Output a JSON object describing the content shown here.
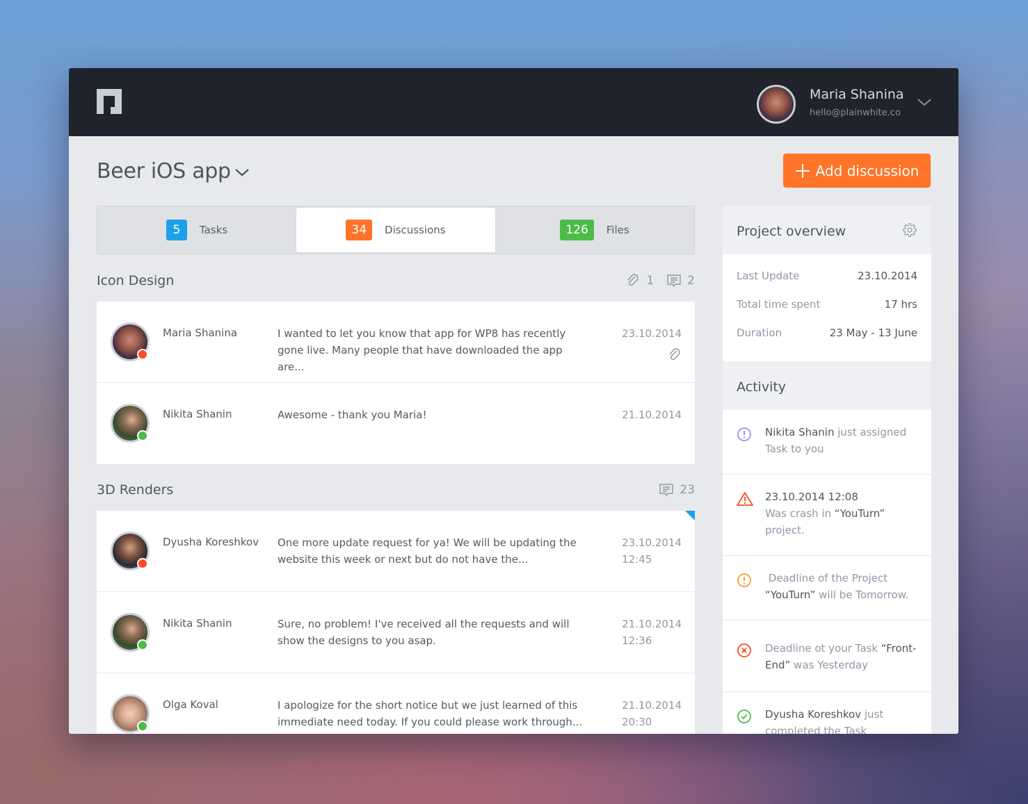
{
  "header": {
    "logo": "plainwhite-logo",
    "user": {
      "name": "Maria Shanina",
      "email": "hello@plainwhite.co",
      "avatar": "avatar-maria"
    }
  },
  "project": {
    "title": "Beer iOS app",
    "add_button_label": "Add discussion"
  },
  "colors": {
    "accent": "#ff7428",
    "tasks": "#1ea0e8",
    "discussions": "#ff7428",
    "files": "#4cbb48",
    "online": "#4cbb48",
    "busy": "#ff4a24",
    "topbar": "#1f232b"
  },
  "tabs": [
    {
      "count": "5",
      "label": "Tasks",
      "active": false
    },
    {
      "count": "34",
      "label": "Discussions",
      "active": true
    },
    {
      "count": "126",
      "label": "Files",
      "active": false
    }
  ],
  "sections": [
    {
      "title": "Icon Design",
      "attachments": "1",
      "comments": "2",
      "rows": [
        {
          "name": "Maria Shanina",
          "status": "busy",
          "message": "I wanted to let you know that app for WP8 has recently gone live. Many people that have downloaded the app are...",
          "date": "23.10.2014",
          "time": "",
          "has_attachment": true
        },
        {
          "name": "Nikita Shanin",
          "status": "online",
          "message": "Awesome - thank you Maria!",
          "date": "21.10.2014",
          "time": "",
          "has_attachment": false
        }
      ]
    },
    {
      "title": "3D Renders",
      "comments": "23",
      "rows": [
        {
          "name": "Dyusha Koreshkov",
          "status": "busy",
          "message": "One more update request for ya! We will be updating the website this week or next but do not have the...",
          "date": "23.10.2014",
          "time": "12:45",
          "unread": true
        },
        {
          "name": "Nikita Shanin",
          "status": "online",
          "message": "Sure, no problem! I've received all the requests and will show the designs to you asap.",
          "date": "21.10.2014",
          "time": "12:36"
        },
        {
          "name": "Olga Koval",
          "status": "online",
          "message": "I apologize for the short notice but we just learned of this immediate need today. If you could please work through...",
          "date": "21.10.2014",
          "time": "20:30"
        }
      ]
    }
  ],
  "overview": {
    "title": "Project overview",
    "rows": [
      {
        "label": "Last Update",
        "value": "23.10.2014"
      },
      {
        "label": "Total time spent",
        "value": "17 hrs"
      },
      {
        "label": "Duration",
        "value": "23 May - 13 June"
      }
    ]
  },
  "activity": {
    "title": "Activity",
    "items": [
      {
        "icon": "info-circle-icon",
        "color": "#a08cf0",
        "strong": "Nikita Shanin",
        "text": " just assigned Task to you"
      },
      {
        "icon": "warning-triangle-icon",
        "color": "#ff4a24",
        "strong": "23.10.2014 12:08",
        "line2": "Was crash in ",
        "quote": "“YouTurn”",
        "text2": " project."
      },
      {
        "icon": "alert-circle-icon",
        "color": "#ff9a28",
        "text": " Deadline of the Project ",
        "quote": "“YouTurn”",
        "text2": " will be Tomorrow."
      },
      {
        "icon": "x-circle-icon",
        "color": "#ff4a24",
        "text": "Deadline ot your Task ",
        "quote": "“Front-End”",
        "text2": " was Yesterday"
      },
      {
        "icon": "check-circle-icon",
        "color": "#4cbb48",
        "strong": "Dyusha Koreshkov",
        "text": " just completed the Task"
      }
    ]
  }
}
